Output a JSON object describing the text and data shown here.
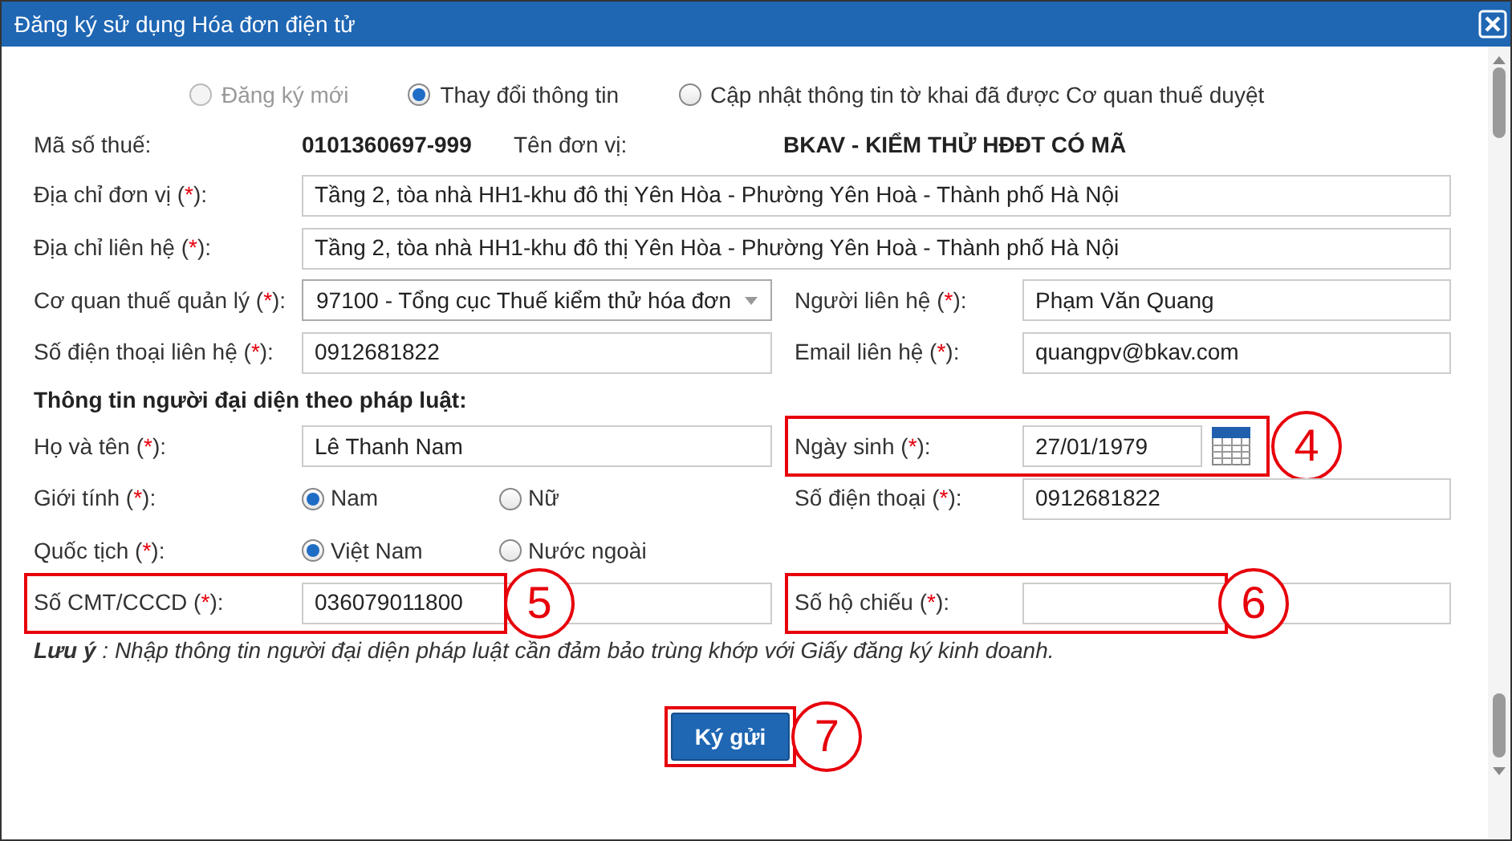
{
  "window": {
    "title": "Đăng ký sử dụng Hóa đơn điện tử"
  },
  "registration_options": [
    {
      "label": "Đăng ký mới",
      "selected": false,
      "disabled": true
    },
    {
      "label": "Thay đổi thông tin",
      "selected": true,
      "disabled": false
    },
    {
      "label": "Cập nhật thông tin tờ khai đã được Cơ quan thuế duyệt",
      "selected": false,
      "disabled": false
    }
  ],
  "rows": [
    {
      "kind": "info",
      "left": {
        "label": "Mã số thuế:",
        "value": "0101360697-999"
      },
      "right": {
        "label": "Tên đơn vị:",
        "value": "BKAV - KIỂM THỬ HĐĐT CÓ MÃ"
      }
    },
    {
      "kind": "wide",
      "field": {
        "label": "Địa chỉ đơn vị (*):",
        "value": "Tầng 2, tòa nhà HH1-khu đô thị Yên Hòa - Phường Yên Hoà - Thành phố Hà Nội"
      }
    },
    {
      "kind": "wide",
      "field": {
        "label": "Địa chỉ liên hệ (*):",
        "value": "Tầng 2, tòa nhà HH1-khu đô thị Yên Hòa - Phường Yên Hoà - Thành phố Hà Nội"
      }
    },
    {
      "kind": "pair",
      "left": {
        "kind": "select",
        "label": "Cơ quan thuế quản lý (*):",
        "value": "97100 - Tổng cục Thuế kiểm thử hóa đơn"
      },
      "right": {
        "kind": "text",
        "label": "Người liên hệ (*):",
        "value": "Phạm Văn Quang"
      }
    },
    {
      "kind": "pair",
      "left": {
        "kind": "text",
        "label": "Số điện thoại liên hệ (*):",
        "value": "0912681822"
      },
      "right": {
        "kind": "text",
        "label": "Email liên hệ (*):",
        "value": "quangpv@bkav.com"
      }
    },
    {
      "kind": "heading",
      "text": "Thông tin người đại diện theo pháp luật:"
    },
    {
      "kind": "pair",
      "left": {
        "kind": "text",
        "label": "Họ và tên (*):",
        "value": "Lê Thanh Nam"
      },
      "right": {
        "kind": "date",
        "label": "Ngày sinh (*):",
        "value": "27/01/1979",
        "callout": "4"
      }
    },
    {
      "kind": "pair",
      "left": {
        "kind": "radio",
        "label": "Giới tính (*):",
        "options": [
          {
            "label": "Nam",
            "selected": true
          },
          {
            "label": "Nữ",
            "selected": false
          }
        ]
      },
      "right": {
        "kind": "text",
        "label": "Số điện thoại (*):",
        "value": "0912681822"
      }
    },
    {
      "kind": "pair",
      "left": {
        "kind": "radio",
        "label": "Quốc tịch (*):",
        "options": [
          {
            "label": "Việt Nam",
            "selected": true
          },
          {
            "label": "Nước ngoài",
            "selected": false
          }
        ]
      }
    },
    {
      "kind": "pair",
      "left": {
        "kind": "text",
        "label": "Số CMT/CCCD (*):",
        "value": "036079011800",
        "callout": "5"
      },
      "right": {
        "kind": "text",
        "label": "Số hộ chiếu (*):",
        "callout": "6"
      }
    },
    {
      "kind": "note",
      "text": "**Lưu ý** : Nhập thông tin người đại diện pháp luật cần đảm bảo trùng khớp với Giấy đăng ký kinh doanh."
    }
  ],
  "submit": {
    "label": "Ký gửi",
    "callout": "7"
  }
}
